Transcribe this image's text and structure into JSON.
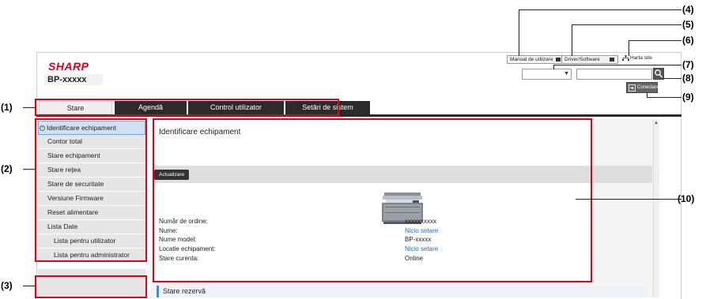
{
  "header": {
    "brand": "SHARP",
    "model": "BP-xxxxx",
    "manual_label": "Manual de utilizare",
    "driver_label": "Driver/Software",
    "sitemap_label": "Harta site",
    "login_label": "Conectare",
    "language_value": "",
    "search_value": ""
  },
  "tabs": [
    {
      "label": "Stare"
    },
    {
      "label": "Agendă"
    },
    {
      "label": "Control utilizator"
    },
    {
      "label": "Setări de sistem"
    }
  ],
  "sidebar": {
    "items": [
      {
        "label": "Identificare echipament"
      },
      {
        "label": "Contor total"
      },
      {
        "label": "Stare echipament"
      },
      {
        "label": "Stare rețea"
      },
      {
        "label": "Stare de securitate"
      },
      {
        "label": "Versiune Firmware"
      },
      {
        "label": "Reset alimentare"
      },
      {
        "label": "Lista Date"
      },
      {
        "label": "Lista pentru utilizator"
      },
      {
        "label": "Lista pentru administrator"
      }
    ]
  },
  "main": {
    "title": "Identificare echipament",
    "update_label": "Actualizare",
    "info": [
      {
        "label": "Număr de ordine:",
        "value": "xxxxxxxxxx"
      },
      {
        "label": "Nume:",
        "value": "Nicio setare"
      },
      {
        "label": "Nume model:",
        "value": "BP-xxxxx"
      },
      {
        "label": "Locatie echipament:",
        "value": "Nicio setare"
      },
      {
        "label": "Stare curenta:",
        "value": "Online"
      }
    ],
    "reserve_section": "Stare rezervă"
  },
  "callouts": [
    "(1)",
    "(2)",
    "(3)",
    "(4)",
    "(5)",
    "(6)",
    "(7)",
    "(8)",
    "(9)",
    "(10)"
  ],
  "colors": {
    "brand": "#d7001d",
    "callout": "#e2001a",
    "tab_dark": "#2b2b2b",
    "link": "#2a6cb8",
    "active_item": "#cfe1f3"
  }
}
